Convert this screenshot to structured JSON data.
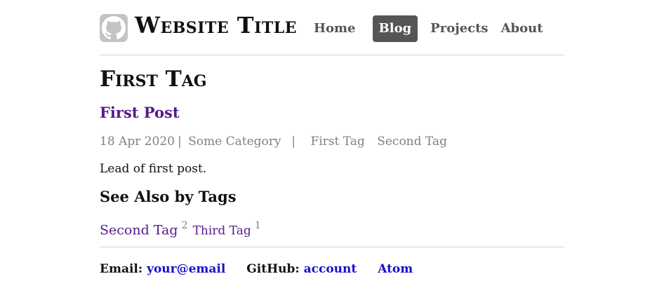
{
  "header": {
    "site_title": "Website Title",
    "nav": [
      {
        "label": "Home"
      },
      {
        "label": "Blog",
        "active": true
      },
      {
        "label": "Projects"
      },
      {
        "label": "About"
      }
    ]
  },
  "page": {
    "title": "First Tag"
  },
  "post": {
    "title": "First Post",
    "date": "18 Apr 2020",
    "category": "Some Category",
    "tags": [
      "First Tag",
      "Second Tag"
    ],
    "lead": "Lead of first post."
  },
  "see_also": {
    "heading": "See Also by Tags",
    "tags": [
      {
        "label": "Second Tag",
        "count": "2"
      },
      {
        "label": "Third Tag",
        "count": "1"
      }
    ]
  },
  "footer": {
    "email_label": "Email:",
    "email_value": "your@email",
    "github_label": "GitHub:",
    "github_value": "account",
    "atom_label": "Atom"
  },
  "colors": {
    "link_visited": "#551a8b",
    "link": "#1a0dcc",
    "nav_active_bg": "#555555",
    "meta_gray": "#808080"
  },
  "icons": {
    "logo": "github-octocat-icon"
  }
}
